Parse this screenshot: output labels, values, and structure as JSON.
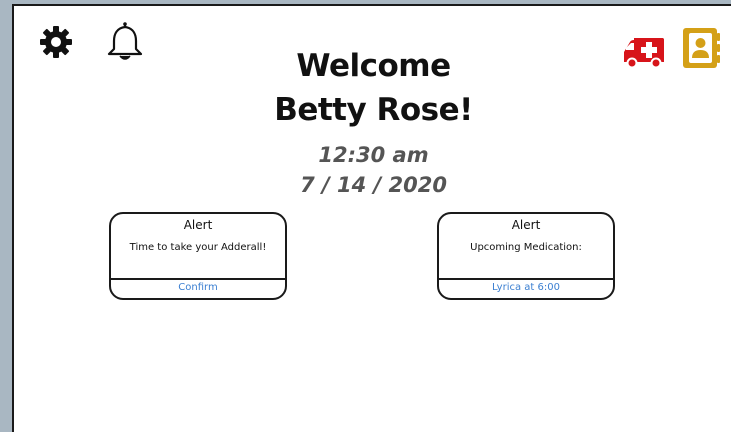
{
  "header": {
    "icons": {
      "settings": "gear-icon",
      "notifications": "bell-icon",
      "emergency": "ambulance-icon",
      "contacts": "contacts-book-icon"
    },
    "colors": {
      "emergency": "#d7141a",
      "contacts": "#d4a017"
    }
  },
  "welcome": {
    "line1": "Welcome",
    "line2": "Betty Rose!"
  },
  "datetime": {
    "time": "12:30 am",
    "date": "7 / 14 / 2020"
  },
  "alerts": [
    {
      "title": "Alert",
      "message": "Time to take your Adderall!",
      "action": "Confirm"
    },
    {
      "title": "Alert",
      "message": "Upcoming Medication:",
      "action": "Lyrica at 6:00"
    }
  ],
  "colors": {
    "link": "#3b7fd1",
    "datetime": "#555555",
    "background": "#a9b7c2"
  }
}
